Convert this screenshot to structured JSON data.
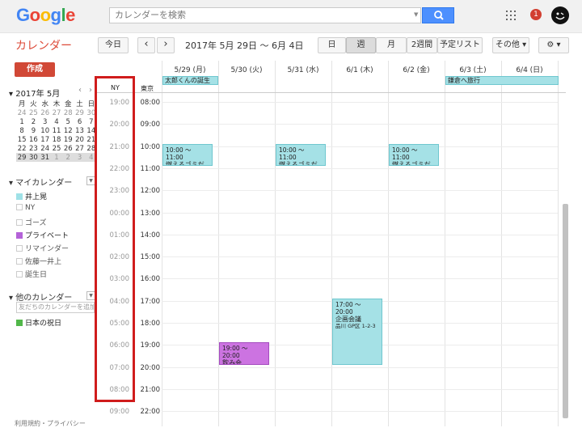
{
  "header": {
    "logo_letters": [
      {
        "ch": "G",
        "color": "#4285f4"
      },
      {
        "ch": "o",
        "color": "#ea4335"
      },
      {
        "ch": "o",
        "color": "#fbbc05"
      },
      {
        "ch": "g",
        "color": "#4285f4"
      },
      {
        "ch": "l",
        "color": "#34a853"
      },
      {
        "ch": "e",
        "color": "#ea4335"
      }
    ],
    "search_placeholder": "カレンダーを検索",
    "notification_count": "1"
  },
  "toolbar": {
    "app_title": "カレンダー",
    "today": "今日",
    "prev": "‹",
    "next": "›",
    "date_range": "2017年 5月 29日 ～ 6月 4日",
    "views": [
      "日",
      "週",
      "月",
      "2週間",
      "予定リスト"
    ],
    "selected_view": "週",
    "more": "その他 ▾",
    "settings": "⚙ ▾"
  },
  "sidebar": {
    "create": "作成",
    "mini_month": "2017年 5月",
    "mini_nav": [
      "‹",
      "›"
    ],
    "weekdays": [
      "月",
      "火",
      "水",
      "木",
      "金",
      "土",
      "日"
    ],
    "weeks": [
      [
        "24",
        "25",
        "26",
        "27",
        "28",
        "29",
        "30"
      ],
      [
        "1",
        "2",
        "3",
        "4",
        "5",
        "6",
        "7"
      ],
      [
        "8",
        "9",
        "10",
        "11",
        "12",
        "13",
        "14"
      ],
      [
        "15",
        "16",
        "17",
        "18",
        "19",
        "20",
        "21"
      ],
      [
        "22",
        "23",
        "24",
        "25",
        "26",
        "27",
        "28"
      ],
      [
        "29",
        "30",
        "31",
        "1",
        "2",
        "3",
        "4"
      ]
    ],
    "my_calendars_title": "マイカレンダー",
    "my_calendars": [
      {
        "label": "井上晃",
        "color": "#9fe1e7"
      },
      {
        "label": "NY",
        "color": "#ffffff"
      },
      {
        "label": "ゴーズ",
        "color": "#ffffff"
      },
      {
        "label": "プライベート",
        "color": "#b462d8"
      },
      {
        "label": "リマインダー",
        "color": "#ffffff"
      },
      {
        "label": "佐藤一井上",
        "color": "#ffffff"
      },
      {
        "label": "誕生日",
        "color": "#ffffff"
      }
    ],
    "other_calendars_title": "他のカレンダー",
    "friend_placeholder": "友だちのカレンダーを追加",
    "other_calendars": [
      {
        "label": "日本の祝日",
        "color": "#51b749"
      }
    ],
    "footer": "利用規約・プライバシー"
  },
  "calendar": {
    "days": [
      "5/29 (月)",
      "5/30 (火)",
      "5/31 (水)",
      "6/1 (木)",
      "6/2 (金)",
      "6/3 (土)",
      "6/4 (日)"
    ],
    "tz_labels": {
      "ny": "NY",
      "tokyo": "東京"
    },
    "ny_times": [
      "19:00",
      "20:00",
      "21:00",
      "22:00",
      "23:00",
      "00:00",
      "01:00",
      "02:00",
      "03:00",
      "04:00",
      "05:00",
      "06:00",
      "07:00",
      "08:00",
      "09:00"
    ],
    "tokyo_times": [
      "08:00",
      "09:00",
      "10:00",
      "11:00",
      "12:00",
      "13:00",
      "14:00",
      "15:00",
      "16:00",
      "17:00",
      "18:00",
      "19:00",
      "20:00",
      "21:00",
      "22:00"
    ],
    "allday_events": [
      {
        "label": "太郎くんの誕生日",
        "day_index": 0,
        "span_days": 1
      },
      {
        "label": "鎌倉へ旅行",
        "day_index": 5,
        "span_days": 2
      }
    ],
    "events": [
      {
        "time": "10:00 ～ 11:00",
        "title": "燃えるゴミだし",
        "day_index": 0,
        "start": 10,
        "end": 11,
        "color": "#a5e1e6"
      },
      {
        "time": "10:00 ～ 11:00",
        "title": "燃えるゴミだし",
        "day_index": 2,
        "start": 10,
        "end": 11,
        "color": "#a5e1e6"
      },
      {
        "time": "10:00 ～ 11:00",
        "title": "燃えるゴミだし",
        "day_index": 4,
        "start": 10,
        "end": 11,
        "color": "#a5e1e6"
      },
      {
        "time": "17:00 ～ 20:00",
        "title": "企画会議",
        "sub": "品川 GP区 1-2-3",
        "day_index": 3,
        "start": 17,
        "end": 20,
        "color": "#a5e1e6"
      },
      {
        "time": "19:00 ～ 20:00",
        "title": "飲み会",
        "day_index": 1,
        "start": 19,
        "end": 20,
        "color": "#cc73e1"
      }
    ]
  }
}
